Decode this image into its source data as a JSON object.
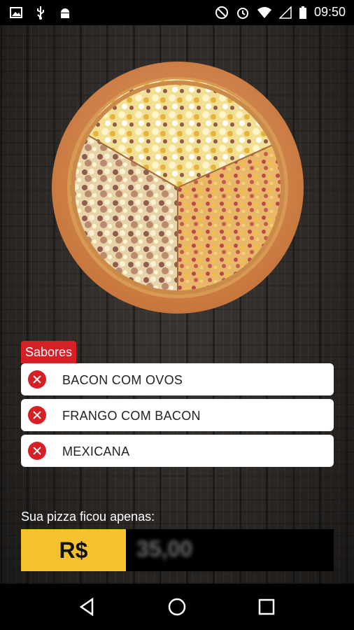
{
  "status_bar": {
    "time": "09:50",
    "left_icons": [
      "image-icon",
      "usb-icon",
      "android-icon"
    ],
    "right_icons": [
      "do-not-disturb-icon",
      "alarm-icon",
      "wifi-icon",
      "signal-icon",
      "battery-icon"
    ]
  },
  "sabores": {
    "title": "Sabores",
    "items": [
      {
        "name": "BACON COM OVOS"
      },
      {
        "name": "FRANGO COM BACON"
      },
      {
        "name": "MEXICANA"
      }
    ]
  },
  "price": {
    "label": "Sua pizza ficou apenas:",
    "currency": "R$",
    "value": "35,00"
  },
  "colors": {
    "accent_red": "#d71f26",
    "price_yellow": "#f5c12e"
  },
  "nav": {
    "icons": [
      "back-icon",
      "home-icon",
      "recents-icon"
    ]
  }
}
